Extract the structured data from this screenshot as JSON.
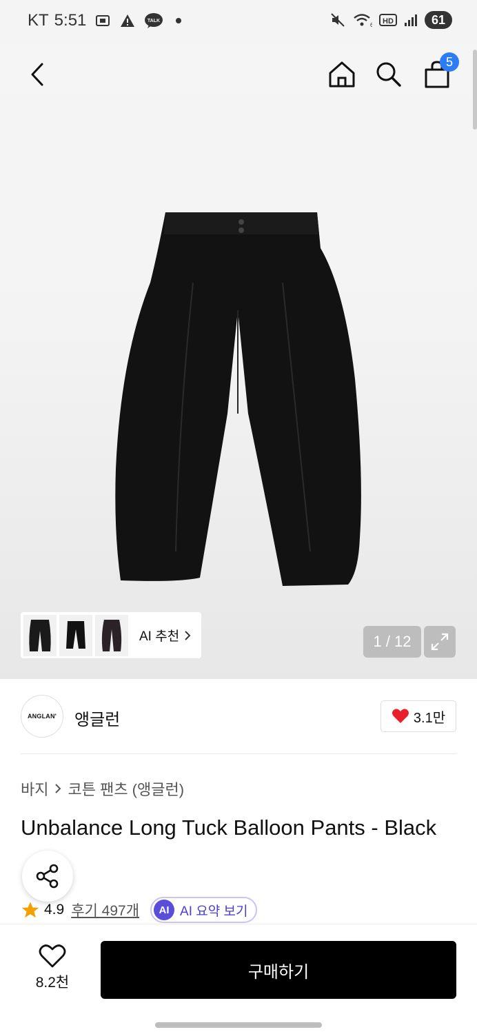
{
  "status_bar": {
    "carrier": "KT",
    "time": "5:51",
    "battery": "61",
    "left_icons": [
      "screen-capture-icon",
      "warning-icon",
      "kakaotalk-icon"
    ],
    "talk_label": "TALK",
    "hd_label": "HD",
    "right_icons": [
      "mute-icon",
      "wifi-6-icon",
      "hd-voice-icon",
      "signal-icon"
    ]
  },
  "header": {
    "cart_count": "5"
  },
  "gallery": {
    "page_indicator": "1 / 12",
    "ai_recommend_label": "AI 추천",
    "thumbnail_count": 3
  },
  "brand": {
    "logo_text": "ANGLAN'",
    "name": "앵글런",
    "likes": "3.1만"
  },
  "product": {
    "breadcrumb": [
      "바지",
      "코튼 팬츠 (앵글런)"
    ],
    "title": "Unbalance Long Tuck Balloon Pants - Black",
    "rating": "4.9",
    "reviews_label": "후기 497개",
    "ai_badge": "AI",
    "ai_summary_label": "AI 요약 보기"
  },
  "bottom_bar": {
    "wishlist_count": "8.2천",
    "buy_label": "구매하기"
  },
  "colors": {
    "accent_blue": "#2c7cf6",
    "heart_red": "#e8202a",
    "star_orange": "#f5a000",
    "ai_purple": "#5b4ddb",
    "buy_button": "#000000"
  }
}
